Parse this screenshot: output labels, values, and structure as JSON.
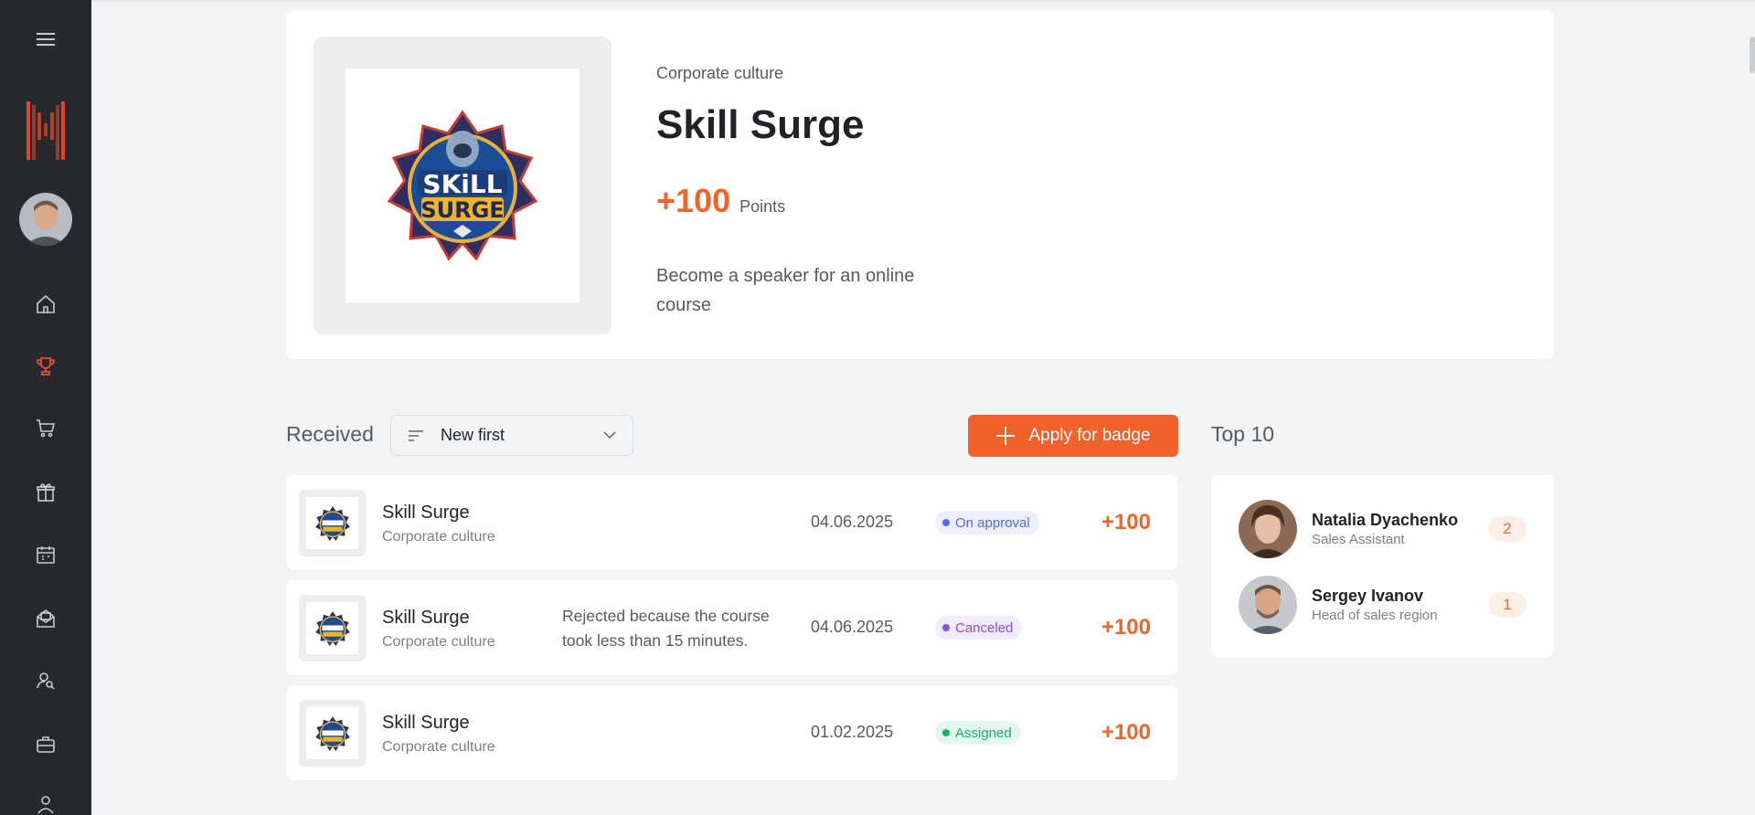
{
  "sidebar": {
    "icons": [
      "menu-icon",
      "logo",
      "avatar",
      "home-icon",
      "trophy-icon",
      "cart-icon",
      "gift-icon",
      "calendar-icon",
      "mail-icon",
      "user-search-icon",
      "briefcase-icon",
      "user-icon"
    ],
    "active": "trophy-icon",
    "accent": "#e8502c"
  },
  "badge": {
    "category": "Corporate culture",
    "title": "Skill Surge",
    "points": "+100",
    "points_label": "Points",
    "description": "Become a speaker for an online course",
    "logo_text_1": "SKiLL",
    "logo_text_2": "SURGE"
  },
  "received": {
    "title": "Received",
    "sort_value": "New first",
    "apply_label": "Apply for badge",
    "rows": [
      {
        "title": "Skill Surge",
        "category": "Corporate culture",
        "note": "",
        "date": "04.06.2025",
        "status": "On approval",
        "points": "+100"
      },
      {
        "title": "Skill Surge",
        "category": "Corporate culture",
        "note": "Rejected because the course took less than 15 minutes.",
        "date": "04.06.2025",
        "status": "Canceled",
        "points": "+100"
      },
      {
        "title": "Skill Surge",
        "category": "Corporate culture",
        "note": "",
        "date": "01.02.2025",
        "status": "Assigned",
        "points": "+100"
      }
    ]
  },
  "top10": {
    "title": "Top 10",
    "items": [
      {
        "name": "Natalia Dyachenko",
        "role": "Sales Assistant",
        "rank": "2"
      },
      {
        "name": "Sergey Ivanov",
        "role": "Head of sales region",
        "rank": "1"
      }
    ]
  },
  "colors": {
    "accent": "#f2612a",
    "status_on_approval": "#4f6bed",
    "status_canceled": "#8b4fd6",
    "status_assigned": "#1cae6a"
  }
}
